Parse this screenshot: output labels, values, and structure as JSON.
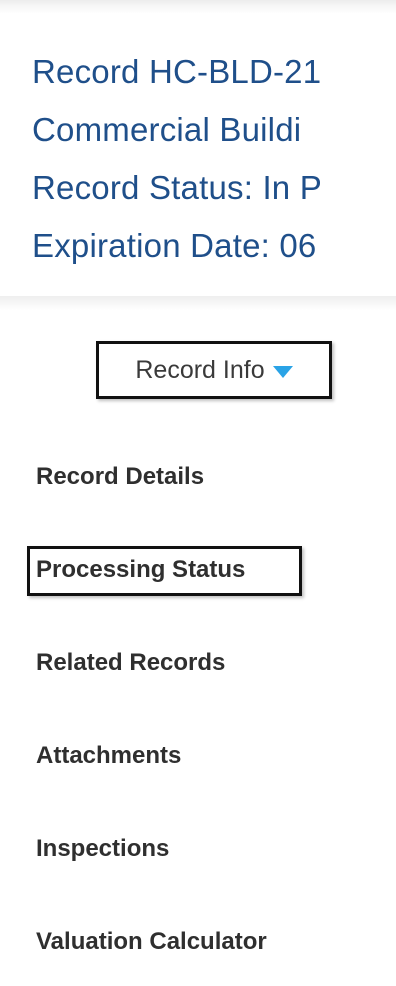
{
  "record_header": {
    "lines": [
      "Record HC-BLD-21",
      "Commercial Buildi",
      "Record Status: In P",
      "Expiration Date: 06"
    ]
  },
  "record_info_menu": {
    "label": "Record Info",
    "icon": "caret-down-icon",
    "accent_color": "#2aa3e6"
  },
  "nav": {
    "items": [
      {
        "label": "Record Details"
      },
      {
        "label": "Processing Status",
        "highlighted": true
      },
      {
        "label": "Related Records"
      },
      {
        "label": "Attachments"
      },
      {
        "label": "Inspections"
      },
      {
        "label": "Valuation Calculator"
      }
    ]
  },
  "colors": {
    "header_text": "#1f4f8a",
    "nav_text": "#2f2f2f"
  }
}
